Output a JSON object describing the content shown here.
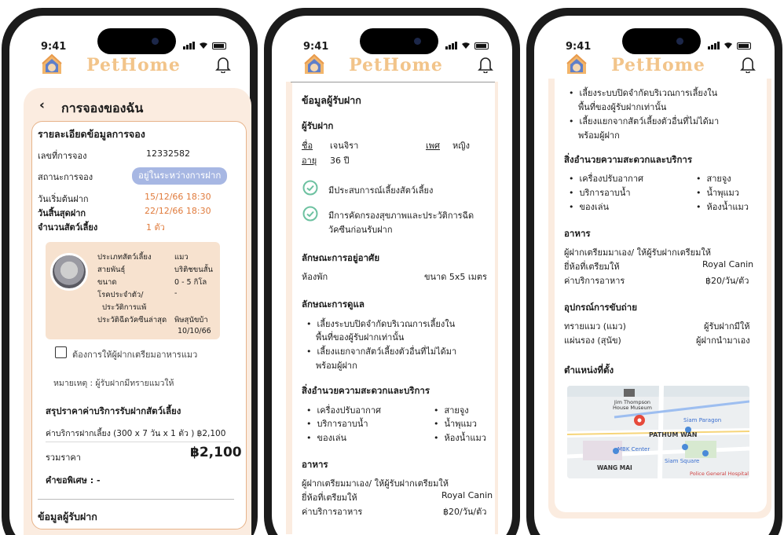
{
  "status_bar": {
    "time": "9:41"
  },
  "app": {
    "brand": "PetHome",
    "brand_color": "#f2c48a"
  },
  "screen1": {
    "back_icon": "chevron-left-icon",
    "title": "การจองของฉัน",
    "section_title": "รายละเอียดข้อมูลการจอง",
    "booking": [
      {
        "label": "เลขที่การจอง",
        "value": "12332582"
      },
      {
        "label": "สถานะการจอง",
        "value": "อยู่ในระหว่างการฝาก"
      },
      {
        "label": "วันเริ่มต้นฝาก",
        "value": "15/12/66 18:30"
      },
      {
        "label": "วันสิ้นสุดฝาก",
        "value": "22/12/66 18:30"
      },
      {
        "label": "จำนวนสัตว์เลี้ยง",
        "value": "1 ตัว"
      }
    ],
    "pet": [
      {
        "label": "ประเภทสัตว์เลี้ยง",
        "value": "แมว"
      },
      {
        "label": "สายพันธุ์",
        "value": "บริติชขนสั้น"
      },
      {
        "label": "ขนาด",
        "value": "0 - 5 กิโล"
      },
      {
        "label": "โรคประจำตัว/",
        "value": "-"
      },
      {
        "label": "ประวัติการแพ้",
        "value": ""
      },
      {
        "label": "ประวัติฉีดวัคซีนล่าสุด",
        "value": "พิษสุนัขบ้า"
      },
      {
        "label": "",
        "value": "10/10/66"
      }
    ],
    "food_checkbox_label": "ต้องการให้ผู้ฝากเตรียมอาหารแมว",
    "note": "หมายเหตุ : ผู้รับฝากมีทรายแมวให้",
    "price_title": "สรุปราคาค่าบริการรับฝากสัตว์เลี้ยง",
    "price_line": "ค่าบริการฝากเลี้ยง (300 x 7 วัน x 1 ตัว ) ฿2,100",
    "total_label": "รวมราคา",
    "total_value": "฿2,100",
    "special_request": "คำขอพิเศษ : -",
    "next_section": "ข้อมูลผู้รับฝาก"
  },
  "screen2": {
    "title": "ข้อมูลผู้รับฝาก",
    "caretaker_heading": "ผู้รับฝาก",
    "name_label": "ชื่อ",
    "name_value": "เจนจิรา",
    "gender_label": "เพศ",
    "gender_value": "หญิง",
    "age_label": "อายุ",
    "age_value": "36 ปี",
    "qualifications": [
      "มีประสบการณ์เลี้ยงสัตว์เลี้ยง",
      "มีการคัดกรองสุขภาพและประวัติการฉีด",
      "วัคซีนก่อนรับฝาก"
    ],
    "housing_heading": "ลักษณะการอยู่อาศัย",
    "housing_value": "ห้องพัก",
    "housing_size": "ขนาด  5x5  เมตร",
    "care_heading": "ลักษณะการดูแล",
    "care_items": [
      "เลี้ยงระบบปิดจำกัดบริเวณการเลี้ยงใน",
      "พื้นที่ของผู้รับฝากเท่านั้น",
      "เลี้ยงแยกจากสัตว์เลี้ยงตัวอื่นที่ไม่ได้มา",
      "พร้อมผู้ฝาก"
    ],
    "amenities_heading": "สิ่งอำนวยความสะดวกและบริการ",
    "amenities_left": [
      "เครื่องปรับอากาศ",
      "บริการอาบน้ำ",
      "ของเล่น"
    ],
    "amenities_right": [
      "สายจูง",
      "น้ำพุแมว",
      "ห้องน้ำแมว"
    ],
    "food_heading": "อาหาร",
    "food_line": "ผู้ฝากเตรียมมาเอง/ ให้ผู้รับฝากเตรียมให้",
    "brand_label": "ยี่ห้อที่เตรียมให้",
    "brand_value": "Royal Canin",
    "food_price_label": "ค่าบริการอาหาร",
    "food_price_value": "฿20/วัน/ตัว"
  },
  "screen3": {
    "care_items": [
      "เลี้ยงระบบปิดจำกัดบริเวณการเลี้ยงใน",
      "พื้นที่ของผู้รับฝากเท่านั้น",
      "เลี้ยงแยกจากสัตว์เลี้ยงตัวอื่นที่ไม่ได้มา",
      "พร้อมผู้ฝาก"
    ],
    "amenities_heading": "สิ่งอำนวยความสะดวกและบริการ",
    "amenities_left": [
      "เครื่องปรับอากาศ",
      "บริการอาบน้ำ",
      "ของเล่น"
    ],
    "amenities_right": [
      "สายจูง",
      "น้ำพุแมว",
      "ห้องน้ำแมว"
    ],
    "food_heading": "อาหาร",
    "food_line": "ผู้ฝากเตรียมมาเอง/ ให้ผู้รับฝากเตรียมให้",
    "brand_label": "ยี่ห้อที่เตรียมให้",
    "brand_value": "Royal Canin",
    "food_price_label": "ค่าบริการอาหาร",
    "food_price_value": "฿20/วัน/ตัว",
    "excretion_heading": "อุปกรณ์การขับถ่าย",
    "litter_label": "ทรายแมว (แมว)",
    "litter_value": "ผู้รับฝากมีให้",
    "pad_label": "แผ่นรอง (สุนัข)",
    "pad_value": "ผู้ฝากนำมาเอง",
    "location_heading": "ตำแหน่งที่ตั้ง",
    "map_labels": {
      "museum": "Jim Thompson House Museum",
      "paragon": "Siam Paragon",
      "pathum_wan": "PATHUM WAN",
      "mbk": "MBK Center",
      "siam_square": "Siam Square",
      "wang_mai": "WANG MAI",
      "hospital": "Police General Hospital"
    }
  },
  "colors": {
    "accent": "#e07b3c",
    "status_badge": "#a7b7e3",
    "panel": "#fbece0",
    "check": "#6cc1a0"
  }
}
